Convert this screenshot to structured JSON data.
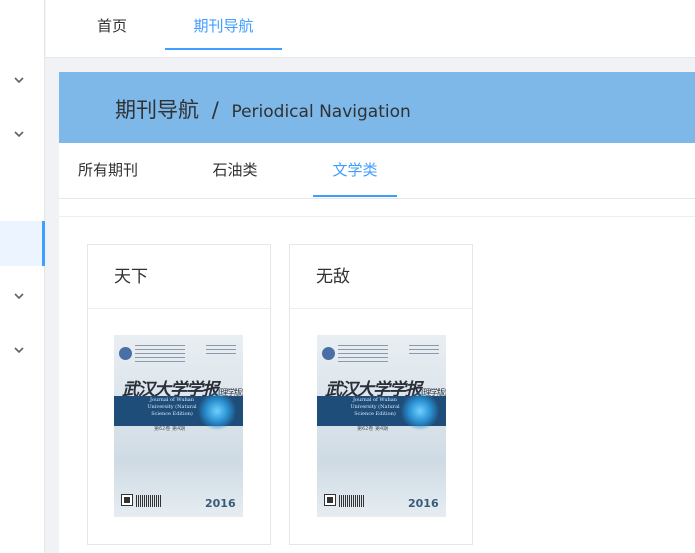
{
  "top_tabs": [
    {
      "label": "首页",
      "active": false
    },
    {
      "label": "期刊导航",
      "active": true
    }
  ],
  "banner": {
    "title": "期刊导航",
    "separator": "/",
    "subtitle": "Periodical Navigation"
  },
  "category_tabs": [
    {
      "label": "所有期刊",
      "active": false
    },
    {
      "label": "石油类",
      "active": false
    },
    {
      "label": "文学类",
      "active": true
    }
  ],
  "journals": [
    {
      "name": "天下",
      "cover": {
        "calligraphy": "武汉大学学报",
        "edition": "(理学版)",
        "band_text": "Journal of Wuhan University (Natural Science Edition)",
        "issue": "第62卷 第4期",
        "year": "2016"
      }
    },
    {
      "name": "无敌",
      "cover": {
        "calligraphy": "武汉大学学报",
        "edition": "(理学版)",
        "band_text": "Journal of Wuhan University (Natural Science Edition)",
        "issue": "第62卷 第4期",
        "year": "2016"
      }
    }
  ],
  "colors": {
    "accent": "#409eff",
    "banner_bg": "#7db8e8",
    "cover_band": "#1e4d7a"
  },
  "icons": {
    "sidebar_chevron": "chevron-down-icon"
  }
}
